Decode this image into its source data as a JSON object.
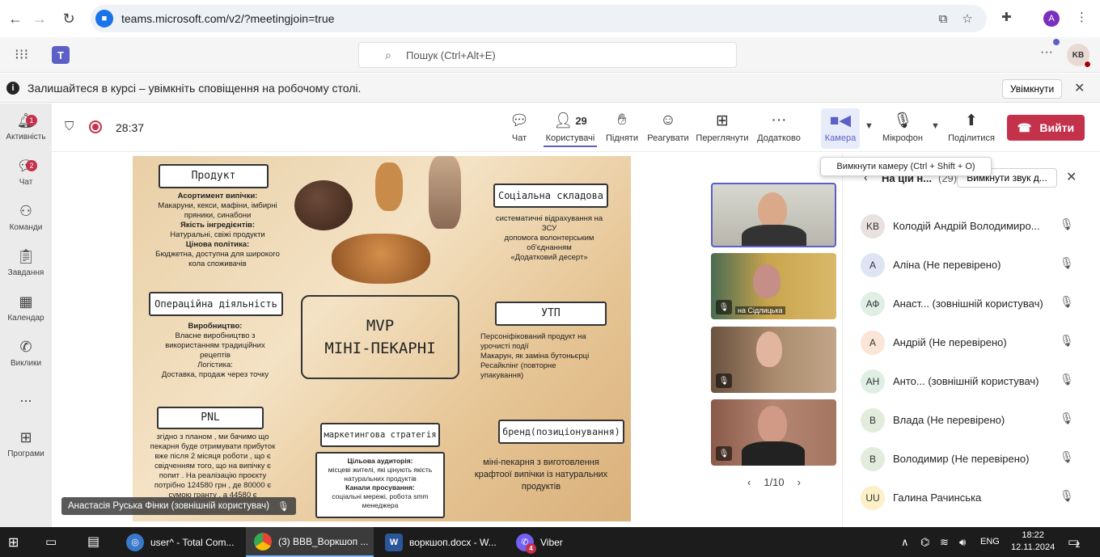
{
  "browser": {
    "url": "teams.microsoft.com/v2/?meetingjoin=true",
    "profile_initial": "A"
  },
  "teams": {
    "search_placeholder": "Пошук (Ctrl+Alt+E)",
    "user_initials": "KB"
  },
  "notification": {
    "message": "Залишайтеся в курсі – увімкніть сповіщення на робочому столі.",
    "enable_label": "Увімкнути"
  },
  "rail": {
    "items": [
      {
        "label": "Активність",
        "badge": "1"
      },
      {
        "label": "Чат",
        "badge": "2"
      },
      {
        "label": "Команди"
      },
      {
        "label": "Завдання"
      },
      {
        "label": "Календар"
      },
      {
        "label": "Виклики"
      },
      {
        "label": "Програми"
      }
    ],
    "more": "..."
  },
  "meeting": {
    "timer": "28:37",
    "participants_count": "29",
    "buttons": {
      "chat": "Чат",
      "users": "Користувачі",
      "raise": "Підняти",
      "react": "Реагувати",
      "view": "Переглянути",
      "more": "Додатково",
      "camera": "Камера",
      "mic": "Мікрофон",
      "share": "Поділитися",
      "leave": "Вийти"
    },
    "tooltip": "Вимкнути камеру (Ctrl + Shift + O)"
  },
  "slide": {
    "product_title": "Продукт",
    "product_lines": [
      "Асортимент випічки:",
      "Макаруни, кекси, мафіни, імбирні",
      "пряники, синабони",
      "Якість інгредієнтів:",
      "Натуральні, свіжі продукти",
      "Цінова політика:",
      "Бюджетна, доступна для широкого",
      "кола споживачів"
    ],
    "social_title": "Соціальна складова",
    "social_lines": [
      "систематичні відрахування на",
      "ЗСУ",
      "допомога волонтерським",
      "об'єднанням",
      "«Додатковий десерт»"
    ],
    "ops_title": "Операційна діяльність",
    "ops_lines": [
      "Виробництво:",
      "Власне виробництво з",
      "використанням традиційних",
      "рецептів",
      "Логістика:",
      "Доставка, продаж через точку"
    ],
    "mvp_line1": "MVP",
    "mvp_line2": "МІНІ-ПЕКАРНІ",
    "utp_title": "УТП",
    "utp_lines": [
      "Персоніфікований продукт на",
      "урочисті події",
      "Макарун, як заміна бутоньєрці",
      "Ресайклінг (повторне",
      "упакування)"
    ],
    "pnl_title": "PNL",
    "pnl_lines": [
      "згідно з планом , ми бачимо що",
      "пекарня буде отримувати прибуток",
      "вже після 2 місяця роботи , що є",
      "свідченням того, що на випічку є",
      "попит . На реалізацію проєкту",
      "потрібно 124580 грн , де 80000 є",
      "сумою гранту , а 44580 є"
    ],
    "marketing_title": "маркетингова стратегія",
    "marketing_lines": [
      "Цільова аудиторія:",
      "місцеві жителі, які цінують якість",
      "натуральних продуктів",
      "Канали просування:",
      "соціальні мережі, робота smm",
      "менеджера"
    ],
    "brand_title": "бренд(позиціонування)",
    "brand_lines": [
      "міні-пекарня з виготовлення",
      "крафтоої випічки із натуральних",
      "продуктів"
    ]
  },
  "speaker_label": "Анастасія Руська Фінки (зовнішній користувач)",
  "tiles": {
    "tile2_label": "на Сідлицька"
  },
  "pager": "1/10",
  "people": {
    "title": "На цій н...",
    "count": "(29)",
    "mute_all": "Вимкнути звук д...",
    "list": [
      {
        "initials": "KB",
        "name": "Колодій Андрій Володимиро...",
        "color": "#e9e1df"
      },
      {
        "initials": "A",
        "name": "Аліна (Не перевірено)",
        "color": "#dfe4f5"
      },
      {
        "initials": "АФ",
        "name": "Анаст... (зовнішній користувач)",
        "color": "#e0efe4"
      },
      {
        "initials": "A",
        "name": "Андрій (Не перевірено)",
        "color": "#fbe5d6"
      },
      {
        "initials": "АН",
        "name": "Анто... (зовнішній користувач)",
        "color": "#e0efe4"
      },
      {
        "initials": "B",
        "name": "Влада (Не перевірено)",
        "color": "#e2ecdc"
      },
      {
        "initials": "B",
        "name": "Володимир (Не перевірено)",
        "color": "#e2ecdc"
      },
      {
        "initials": "UU",
        "name": "Галина Рачинська",
        "color": "#fbf0c8"
      }
    ]
  },
  "taskbar": {
    "apps": [
      {
        "label": "user^ - Total Com..."
      },
      {
        "label": "(3) ВВВ_Воркшоп ..."
      },
      {
        "label": "воркшоп.docx - W..."
      },
      {
        "label": "Viber",
        "badge": "4"
      }
    ],
    "lang": "ENG",
    "time": "18:22",
    "date": "12.11.2024",
    "notif_count": "2"
  },
  "colors": {
    "brand": "#5b5fc7",
    "leave": "#c4314b",
    "taskbar": "#1c1c1c"
  }
}
